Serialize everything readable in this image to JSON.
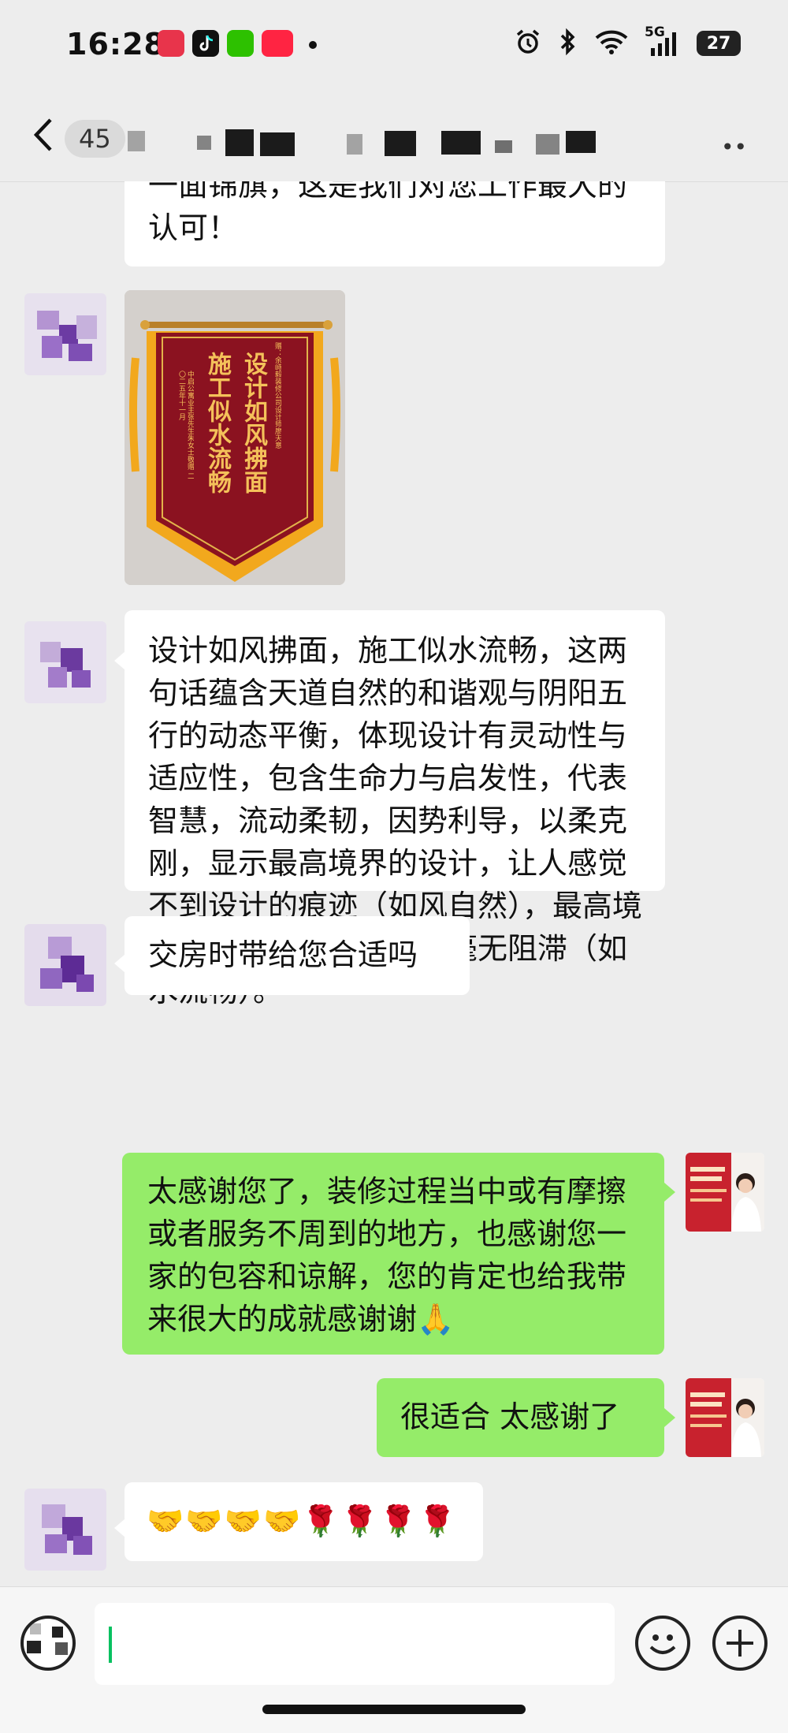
{
  "status_bar": {
    "time": "16:28",
    "network": "5G",
    "battery": "27",
    "icons": [
      "alarm-icon",
      "bluetooth-icon",
      "wifi-icon",
      "signal-icon"
    ],
    "app_icons": [
      "taobao-app-icon",
      "tiktok-app-icon",
      "wechat-app-icon",
      "xiaohongshu-app-icon"
    ]
  },
  "header": {
    "unread_count": "45",
    "title_obscured": true
  },
  "messages": [
    {
      "side": "in",
      "type": "text",
      "text": "一面锦旗，这是我们对您工作最大的认可！"
    },
    {
      "side": "in",
      "type": "image",
      "image": "silk-banner-photo",
      "banner": {
        "left_line": "施工似水流畅",
        "right_line": "设计如风拂面",
        "top_note": "赠：余峙毅装修公司设计师廖天意",
        "bottom_note": "中启公寓业主张先生朱女士敬赠 二〇二五年十一月"
      }
    },
    {
      "side": "in",
      "type": "text",
      "text": "设计如风拂面，施工似水流畅，这两句话蕴含天道自然的和谐观与阴阳五行的动态平衡，体现设计有灵动性与适应性，包含生命力与启发性，代表智慧，流动柔韧，因势利导，以柔克刚，显示最高境界的设计，让人感觉不到设计的痕迹（如风自然），最高境界的施工让人建造过程毫无阻滞（如水流畅）。"
    },
    {
      "side": "in",
      "type": "text",
      "text": "交房时带给您合适吗"
    },
    {
      "side": "out",
      "type": "text",
      "text": "太感谢您了，装修过程当中或有摩擦或者服务不周到的地方，也感谢您一家的包容和谅解，您的肯定也给我带来很大的成就感谢谢🙏"
    },
    {
      "side": "out",
      "type": "text",
      "text": "很适合 太感谢了"
    },
    {
      "side": "in",
      "type": "text",
      "text": "🤝🤝🤝🤝🌹🌹🌹🌹"
    }
  ],
  "input_bar": {
    "value": "",
    "voice_icon": "voice-toggle-icon",
    "emoji_icon": "emoji-icon",
    "plus_icon": "plus-icon"
  },
  "colors": {
    "background": "#ededed",
    "outgoing_bubble": "#95ec69",
    "incoming_bubble": "#ffffff",
    "cursor": "#07c160",
    "banner_red": "#8b1220",
    "banner_gold": "#f2a81d"
  }
}
